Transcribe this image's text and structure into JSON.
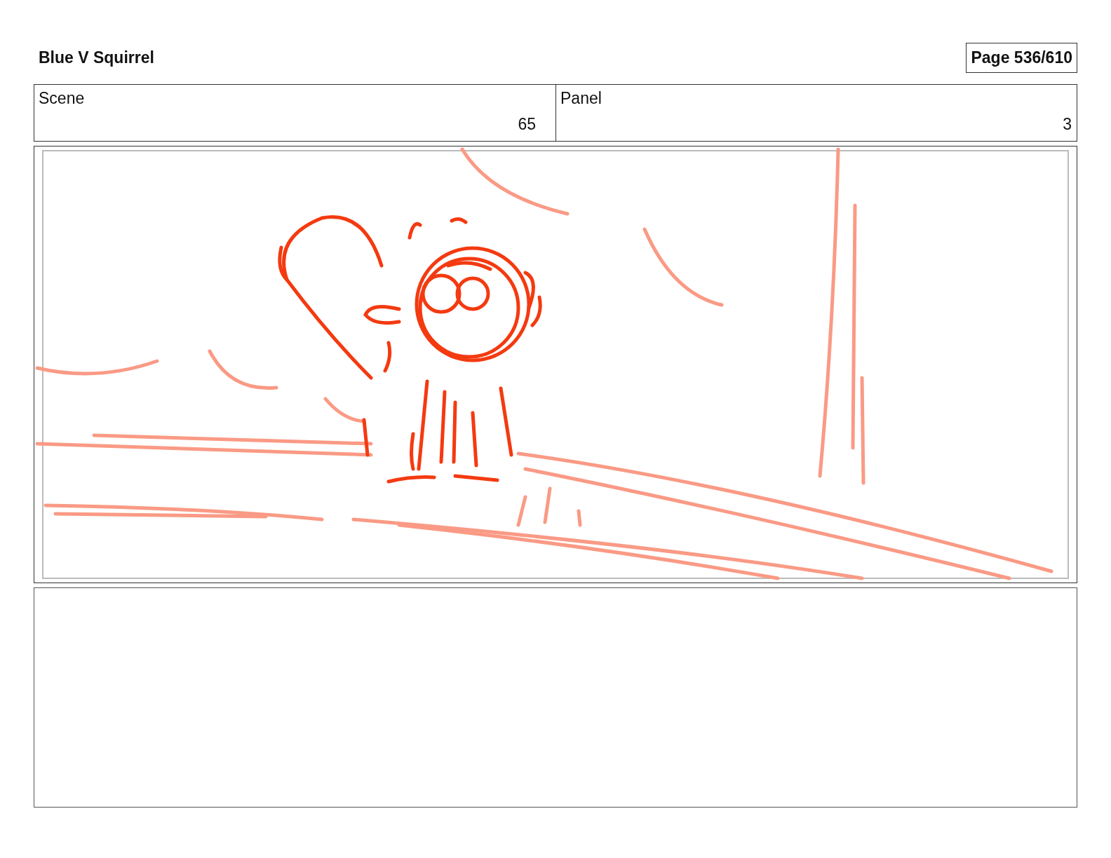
{
  "header": {
    "title": "Blue V Squirrel",
    "page": "Page 536/610"
  },
  "fields": [
    {
      "label": "Scene",
      "value": "65"
    },
    {
      "label": "Panel",
      "value": "3"
    }
  ]
}
